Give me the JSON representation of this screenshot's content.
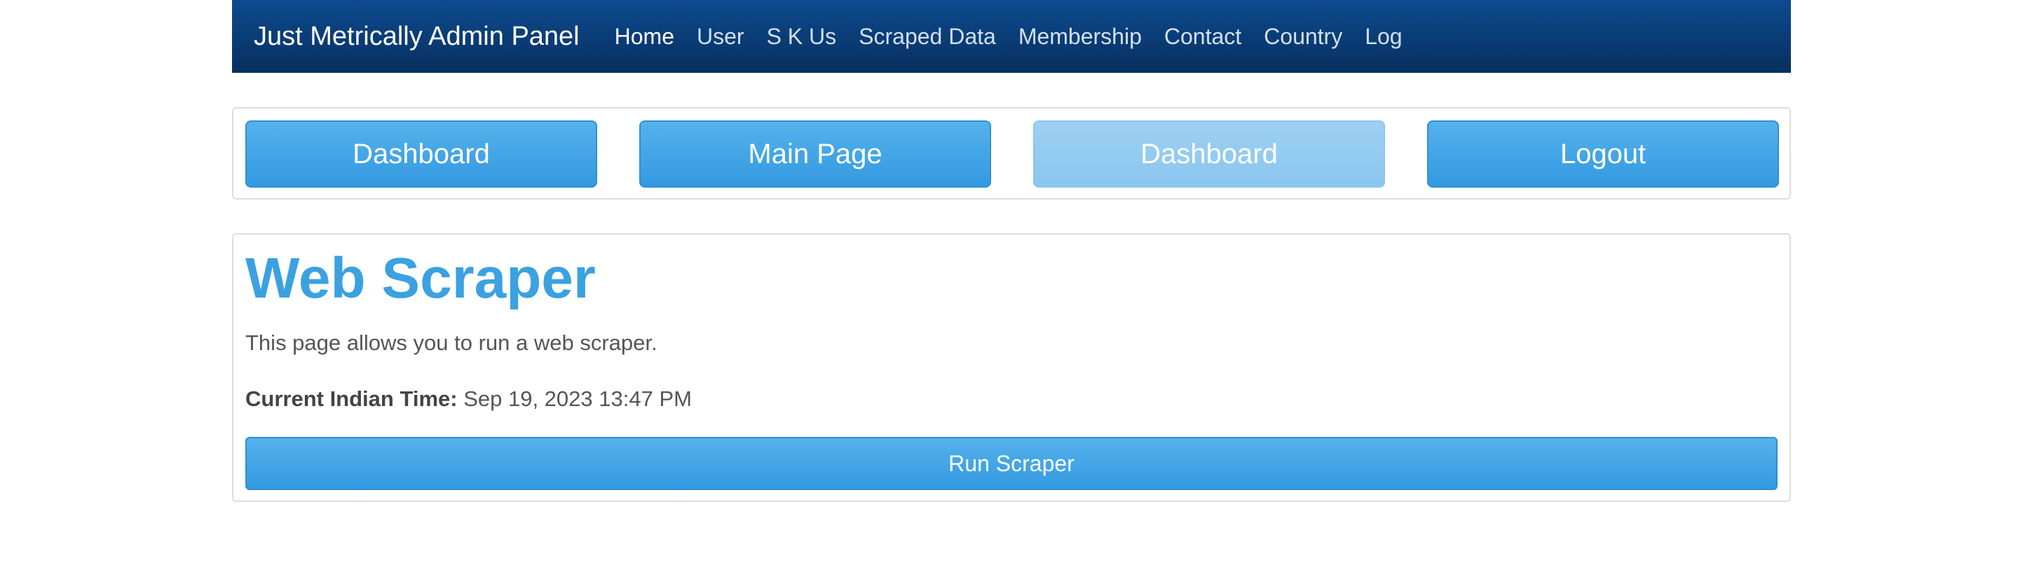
{
  "navbar": {
    "brand": "Just Metrically Admin Panel",
    "links": [
      {
        "label": "Home",
        "active": true
      },
      {
        "label": "User"
      },
      {
        "label": "S K Us"
      },
      {
        "label": "Scraped Data"
      },
      {
        "label": "Membership"
      },
      {
        "label": "Contact"
      },
      {
        "label": "Country"
      },
      {
        "label": "Log"
      }
    ],
    "colors": {
      "background": "#0a3f7c",
      "text": "#ffffff"
    }
  },
  "button_panel": {
    "buttons": [
      {
        "label": "Dashboard",
        "state": "enabled"
      },
      {
        "label": "Main Page",
        "state": "enabled"
      },
      {
        "label": "Dashboard",
        "state": "disabled"
      },
      {
        "label": "Logout",
        "state": "enabled"
      }
    ],
    "colors": {
      "button": "#3ba1e0",
      "disabled_button": "#94cbf0"
    }
  },
  "scraper": {
    "title": "Web Scraper",
    "description": "This page allows you to run a web scraper.",
    "time_label": "Current Indian Time:",
    "time_value": "Sep 19, 2023 13:47 PM",
    "run_button": "Run Scraper",
    "colors": {
      "title": "#3ba1e0"
    }
  }
}
